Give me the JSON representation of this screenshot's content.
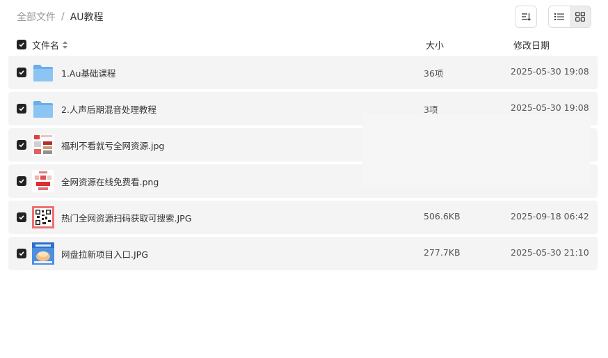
{
  "breadcrumb": {
    "root": "全部文件",
    "separator": "/",
    "current": "AU教程"
  },
  "columns": {
    "name": "文件名",
    "size": "大小",
    "date": "修改日期"
  },
  "files": [
    {
      "name": "1.Au基础课程",
      "size": "36项",
      "date": "2025-05-30 19:08",
      "icon": "folder-icon"
    },
    {
      "name": "2.人声后期混音处理教程",
      "size": "3项",
      "date": "2025-05-30 19:08",
      "icon": "folder-icon"
    },
    {
      "name": "福利不看就亏全网资源.jpg",
      "size": "",
      "date": "",
      "icon": "image-thumbnail"
    },
    {
      "name": "全网资源在线免费看.png",
      "size": "",
      "date": "",
      "icon": "image-thumbnail"
    },
    {
      "name": "热门全网资源扫码获取可搜索.JPG",
      "size": "506.6KB",
      "date": "2025-09-18 06:42",
      "icon": "qr-thumbnail"
    },
    {
      "name": "网盘拉新项目入口.JPG",
      "size": "277.7KB",
      "date": "2025-05-30 21:10",
      "icon": "image-thumbnail"
    }
  ],
  "colors": {
    "row_bg": "#f4f4f5",
    "folder": "#7ab8f0",
    "checkbox": "#222222"
  }
}
